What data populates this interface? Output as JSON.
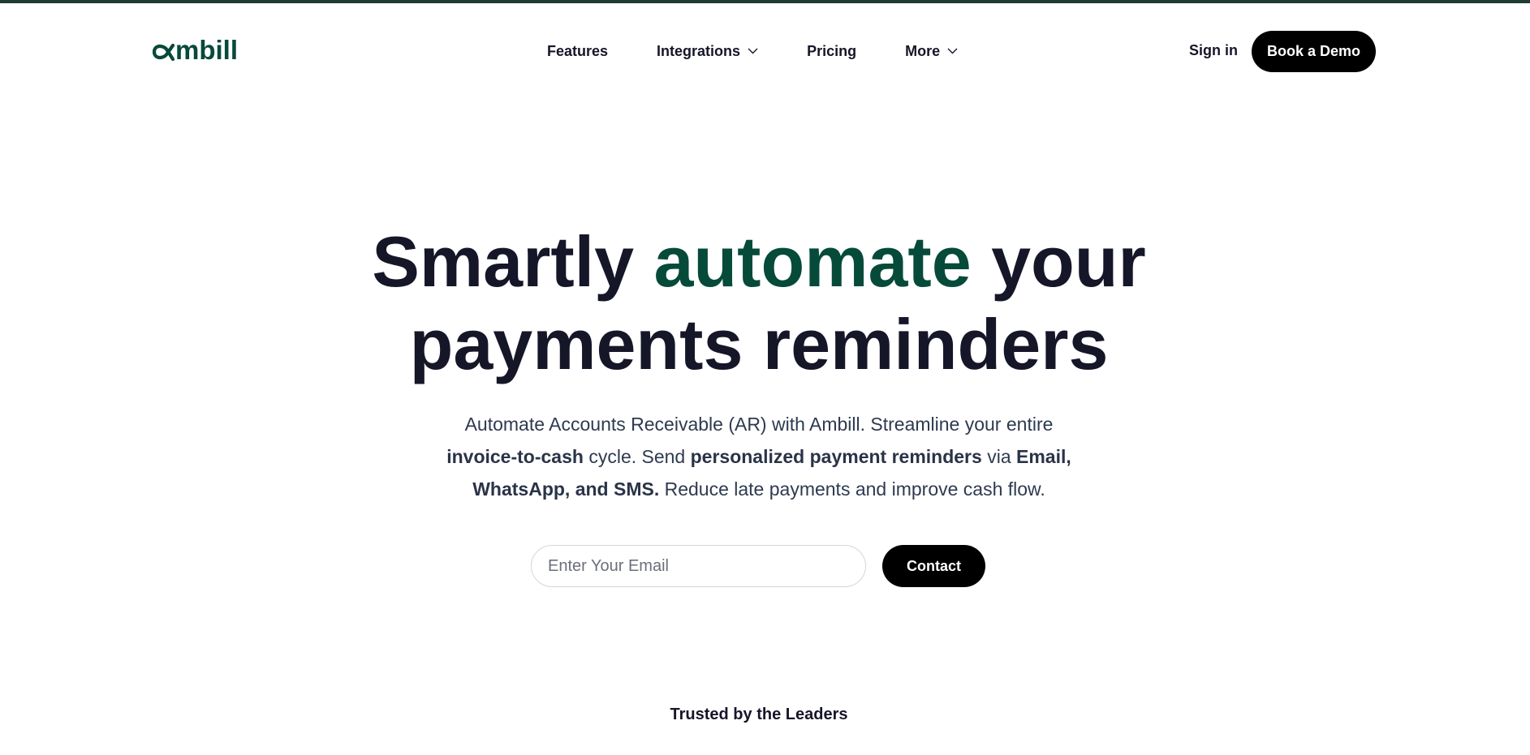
{
  "brand": {
    "logo_text": "ambill",
    "accent_color": "#064a3a",
    "top_strip_color": "#1f3d33"
  },
  "nav": {
    "items": [
      {
        "label": "Features",
        "has_dropdown": false
      },
      {
        "label": "Integrations",
        "has_dropdown": true,
        "icon": "chevron-down-icon"
      },
      {
        "label": "Pricing",
        "has_dropdown": false
      },
      {
        "label": "More",
        "has_dropdown": true,
        "icon": "chevron-down-icon"
      }
    ],
    "sign_in_label": "Sign in",
    "book_demo_label": "Book a Demo"
  },
  "hero": {
    "title_part1": "Smartly ",
    "title_accent": "automate",
    "title_part2": " your",
    "title_line2": "payments reminders",
    "sub_1": "Automate Accounts Receivable (AR) with Ambill. Streamline your entire ",
    "sub_bold_1": "invoice-to-cash",
    "sub_2": " cycle. Send ",
    "sub_bold_2": "personalized payment reminders",
    "sub_3": " via ",
    "sub_bold_3": "Email, WhatsApp, and SMS.",
    "sub_4": " Reduce late payments and improve cash flow.",
    "email_placeholder": "Enter Your Email",
    "contact_label": "Contact"
  },
  "trusted": {
    "heading": "Trusted by the Leaders"
  }
}
